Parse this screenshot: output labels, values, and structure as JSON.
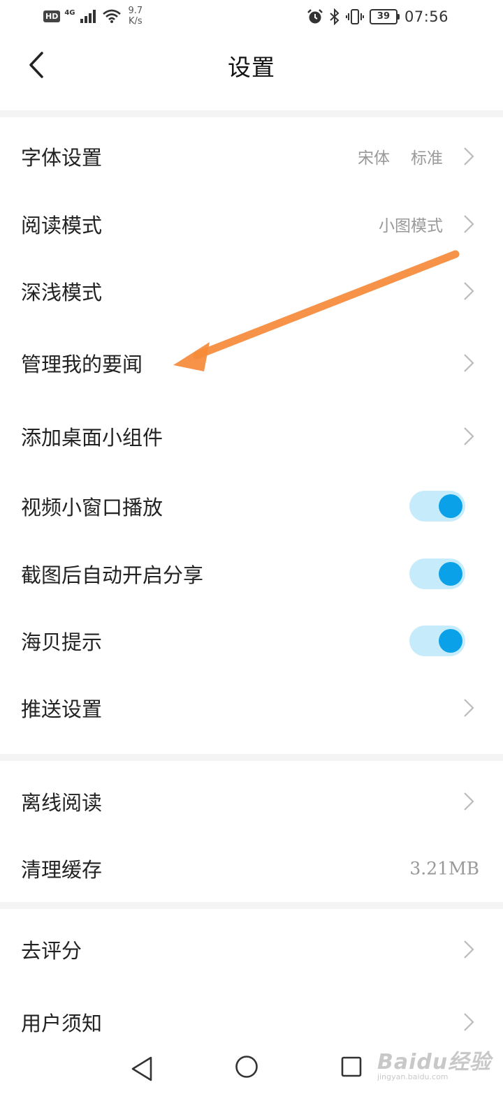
{
  "status_bar": {
    "hd": "HD",
    "network_type": "4G",
    "speed_value": "9.7",
    "speed_unit": "K/s",
    "battery_level": "39",
    "time": "07:56",
    "icons": [
      "hd-icon",
      "signal-icon",
      "wifi-icon",
      "alarm-icon",
      "bluetooth-icon",
      "vibrate-icon",
      "battery-icon"
    ]
  },
  "header": {
    "title": "设置",
    "back_icon": "chevron-left-icon"
  },
  "settings": {
    "font": {
      "label": "字体设置",
      "typeface": "宋体",
      "size": "标准"
    },
    "reading_mode": {
      "label": "阅读模式",
      "value": "小图模式"
    },
    "theme_mode": {
      "label": "深浅模式"
    },
    "manage_news": {
      "label": "管理我的要闻"
    },
    "add_widget": {
      "label": "添加桌面小组件"
    },
    "video_pip": {
      "label": "视频小窗口播放",
      "enabled": true
    },
    "screenshot_share": {
      "label": "截图后自动开启分享",
      "enabled": true
    },
    "haibei_tips": {
      "label": "海贝提示",
      "enabled": true
    },
    "push_settings": {
      "label": "推送设置"
    },
    "offline_reading": {
      "label": "离线阅读"
    },
    "clear_cache": {
      "label": "清理缓存",
      "size": "3.21MB"
    },
    "rate": {
      "label": "去评分"
    },
    "user_notice": {
      "label": "用户须知"
    }
  },
  "colors": {
    "toggle_track": "#c6ecfb",
    "toggle_knob": "#0aa1e8",
    "annotation_arrow": "#f58a3a",
    "section_gap": "#f4f4f4"
  },
  "nav_bar": {
    "icons": [
      "nav-back-icon",
      "nav-home-icon",
      "nav-recents-icon"
    ]
  },
  "watermark": {
    "brand": "Baidu经验",
    "domain": "jingyan.baidu.com"
  }
}
